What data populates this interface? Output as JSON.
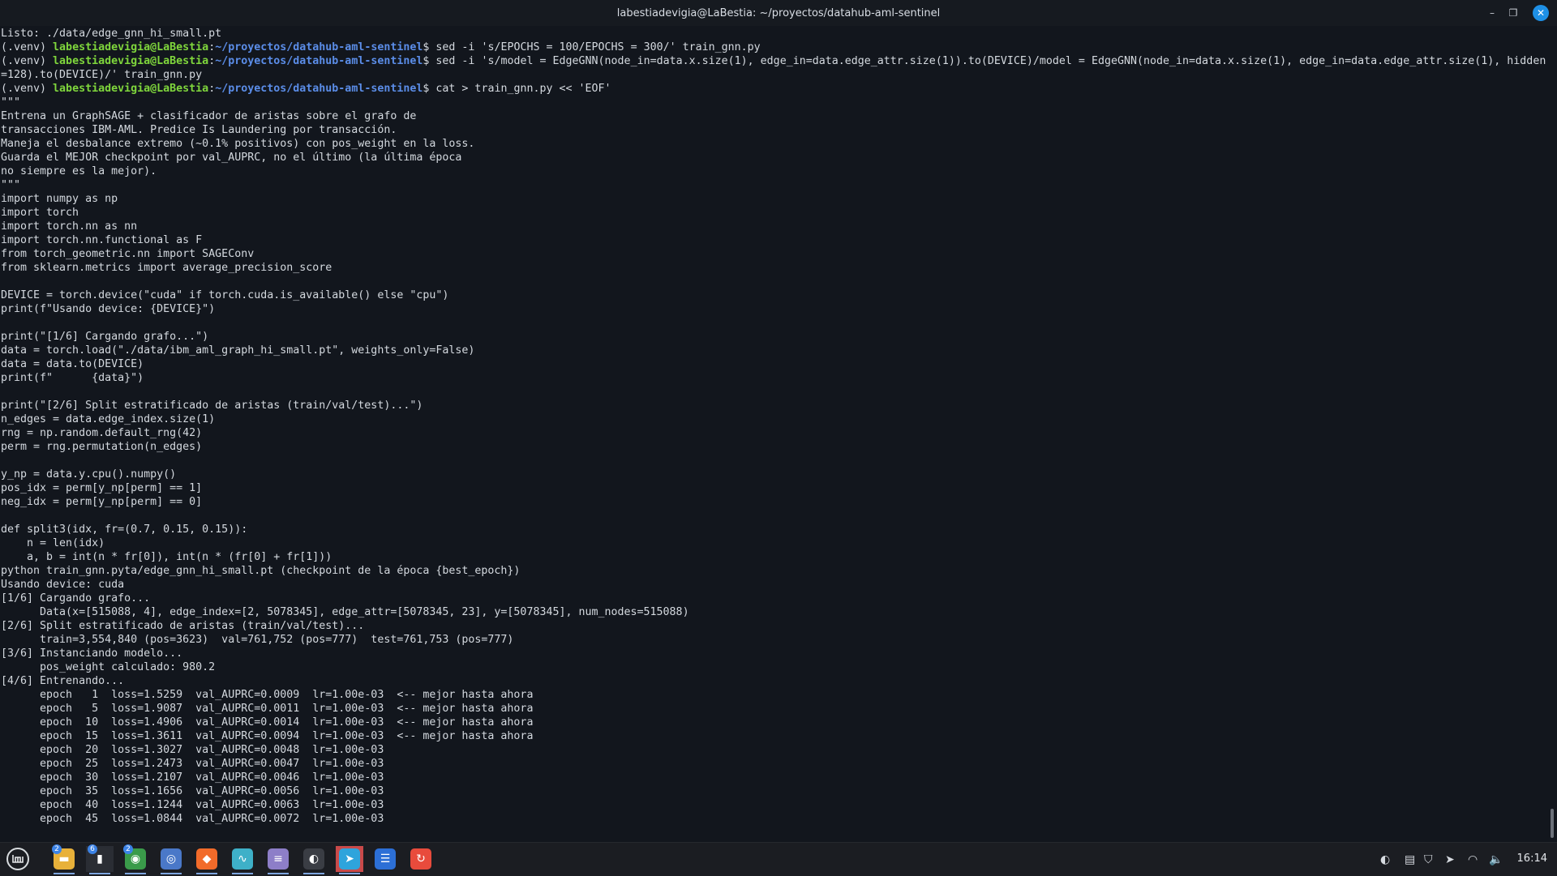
{
  "window": {
    "title": "labestiadevigia@LaBestia: ~/proyectos/datahub-aml-sentinel",
    "minimize_glyph": "–",
    "maximize_glyph": "❐",
    "close_glyph": "✕"
  },
  "terminal": {
    "lines": [
      {
        "text": "Listo: ./data/edge_gnn_hi_small.pt"
      },
      {
        "pre": "(.venv) ",
        "user": "labestiadevigia@LaBestia",
        "sep": ":",
        "path": "~/proyectos/datahub-aml-sentinel",
        "text": "$ sed -i 's/EPOCHS = 100/EPOCHS = 300/' train_gnn.py"
      },
      {
        "pre": "(.venv) ",
        "user": "labestiadevigia@LaBestia",
        "sep": ":",
        "path": "~/proyectos/datahub-aml-sentinel",
        "text": "$ sed -i 's/model = EdgeGNN(node_in=data.x.size(1), edge_in=data.edge_attr.size(1)).to(DEVICE)/model = EdgeGNN(node_in=data.x.size(1), edge_in=data.edge_attr.size(1), hidden"
      },
      {
        "text": "=128).to(DEVICE)/' train_gnn.py"
      },
      {
        "pre": "(.venv) ",
        "user": "labestiadevigia@LaBestia",
        "sep": ":",
        "path": "~/proyectos/datahub-aml-sentinel",
        "text": "$ cat > train_gnn.py << 'EOF'"
      },
      {
        "text": "\"\"\""
      },
      {
        "text": "Entrena un GraphSAGE + clasificador de aristas sobre el grafo de"
      },
      {
        "text": "transacciones IBM-AML. Predice Is Laundering por transacción."
      },
      {
        "text": "Maneja el desbalance extremo (~0.1% positivos) con pos_weight en la loss."
      },
      {
        "text": "Guarda el MEJOR checkpoint por val_AUPRC, no el último (la última época"
      },
      {
        "text": "no siempre es la mejor)."
      },
      {
        "text": "\"\"\""
      },
      {
        "text": "import numpy as np"
      },
      {
        "text": "import torch"
      },
      {
        "text": "import torch.nn as nn"
      },
      {
        "text": "import torch.nn.functional as F"
      },
      {
        "text": "from torch_geometric.nn import SAGEConv"
      },
      {
        "text": "from sklearn.metrics import average_precision_score"
      },
      {
        "text": ""
      },
      {
        "text": "DEVICE = torch.device(\"cuda\" if torch.cuda.is_available() else \"cpu\")"
      },
      {
        "text": "print(f\"Usando device: {DEVICE}\")"
      },
      {
        "text": ""
      },
      {
        "text": "print(\"[1/6] Cargando grafo...\")"
      },
      {
        "text": "data = torch.load(\"./data/ibm_aml_graph_hi_small.pt\", weights_only=False)"
      },
      {
        "text": "data = data.to(DEVICE)"
      },
      {
        "text": "print(f\"      {data}\")"
      },
      {
        "text": ""
      },
      {
        "text": "print(\"[2/6] Split estratificado de aristas (train/val/test)...\")"
      },
      {
        "text": "n_edges = data.edge_index.size(1)"
      },
      {
        "text": "rng = np.random.default_rng(42)"
      },
      {
        "text": "perm = rng.permutation(n_edges)"
      },
      {
        "text": ""
      },
      {
        "text": "y_np = data.y.cpu().numpy()"
      },
      {
        "text": "pos_idx = perm[y_np[perm] == 1]"
      },
      {
        "text": "neg_idx = perm[y_np[perm] == 0]"
      },
      {
        "text": ""
      },
      {
        "text": "def split3(idx, fr=(0.7, 0.15, 0.15)):"
      },
      {
        "text": "    n = len(idx)"
      },
      {
        "text": "    a, b = int(n * fr[0]), int(n * (fr[0] + fr[1]))"
      },
      {
        "text": "python train_gnn.pyta/edge_gnn_hi_small.pt (checkpoint de la época {best_epoch})"
      },
      {
        "text": "Usando device: cuda"
      },
      {
        "text": "[1/6] Cargando grafo..."
      },
      {
        "text": "      Data(x=[515088, 4], edge_index=[2, 5078345], edge_attr=[5078345, 23], y=[5078345], num_nodes=515088)"
      },
      {
        "text": "[2/6] Split estratificado de aristas (train/val/test)..."
      },
      {
        "text": "      train=3,554,840 (pos=3623)  val=761,752 (pos=777)  test=761,753 (pos=777)"
      },
      {
        "text": "[3/6] Instanciando modelo..."
      },
      {
        "text": "      pos_weight calculado: 980.2"
      },
      {
        "text": "[4/6] Entrenando..."
      },
      {
        "text": "      epoch   1  loss=1.5259  val_AUPRC=0.0009  lr=1.00e-03  <-- mejor hasta ahora"
      },
      {
        "text": "      epoch   5  loss=1.9087  val_AUPRC=0.0011  lr=1.00e-03  <-- mejor hasta ahora"
      },
      {
        "text": "      epoch  10  loss=1.4906  val_AUPRC=0.0014  lr=1.00e-03  <-- mejor hasta ahora"
      },
      {
        "text": "      epoch  15  loss=1.3611  val_AUPRC=0.0094  lr=1.00e-03  <-- mejor hasta ahora"
      },
      {
        "text": "      epoch  20  loss=1.3027  val_AUPRC=0.0048  lr=1.00e-03"
      },
      {
        "text": "      epoch  25  loss=1.2473  val_AUPRC=0.0047  lr=1.00e-03"
      },
      {
        "text": "      epoch  30  loss=1.2107  val_AUPRC=0.0046  lr=1.00e-03"
      },
      {
        "text": "      epoch  35  loss=1.1656  val_AUPRC=0.0056  lr=1.00e-03"
      },
      {
        "text": "      epoch  40  loss=1.1244  val_AUPRC=0.0063  lr=1.00e-03"
      },
      {
        "text": "      epoch  45  loss=1.0844  val_AUPRC=0.0072  lr=1.00e-03"
      }
    ]
  },
  "taskbar": {
    "menu_icon": "mint-menu-icon",
    "apps": [
      {
        "name": "files",
        "icon": "folder-icon",
        "glyph": "▬",
        "color": "#e8b13a",
        "badge": "2"
      },
      {
        "name": "terminal",
        "icon": "terminal-icon",
        "glyph": "▮",
        "color": "#2b2e34",
        "badge": "6"
      },
      {
        "name": "chrome",
        "icon": "chrome-icon",
        "glyph": "◉",
        "color": "#3a9b4a",
        "badge": "2"
      },
      {
        "name": "camera",
        "icon": "camera-icon",
        "glyph": "◎",
        "color": "#4a78c8",
        "badge": ""
      },
      {
        "name": "brave",
        "icon": "brave-icon",
        "glyph": "◆",
        "color": "#f26b2a",
        "badge": ""
      },
      {
        "name": "system-monitor",
        "icon": "system-monitor-icon",
        "glyph": "∿",
        "color": "#3eb0c8",
        "badge": ""
      },
      {
        "name": "text-editor",
        "icon": "text-editor-icon",
        "glyph": "≡",
        "color": "#8d7ec8",
        "badge": ""
      },
      {
        "name": "obs",
        "icon": "obs-icon",
        "glyph": "◐",
        "color": "#3a3d44",
        "badge": ""
      },
      {
        "name": "telegram",
        "icon": "telegram-icon",
        "glyph": "➤",
        "color": "#2ea4dc",
        "badge": ""
      },
      {
        "name": "notes",
        "icon": "notes-icon",
        "glyph": "☰",
        "color": "#2c6fd6",
        "badge": ""
      },
      {
        "name": "backup",
        "icon": "backup-icon",
        "glyph": "↻",
        "color": "#e84b3c",
        "badge": ""
      }
    ],
    "tray": [
      {
        "icon": "obs-tray-icon",
        "glyph": "◐"
      },
      {
        "icon": "clipboard-icon",
        "glyph": "▤"
      },
      {
        "icon": "shield-icon",
        "glyph": "⛉"
      },
      {
        "icon": "telegram-tray-icon",
        "glyph": "➤"
      },
      {
        "icon": "wifi-icon",
        "glyph": "◠"
      },
      {
        "icon": "volume-icon",
        "glyph": "🔈"
      }
    ],
    "clock": "16:14"
  },
  "colors": {
    "prompt_user": "#7fd63c",
    "prompt_path": "#5b8de8",
    "terminal_bg": "#12161d",
    "terminal_fg": "#d4d9df",
    "close_button": "#1e90e6",
    "telegram_active_bg": "#c94a4a"
  }
}
